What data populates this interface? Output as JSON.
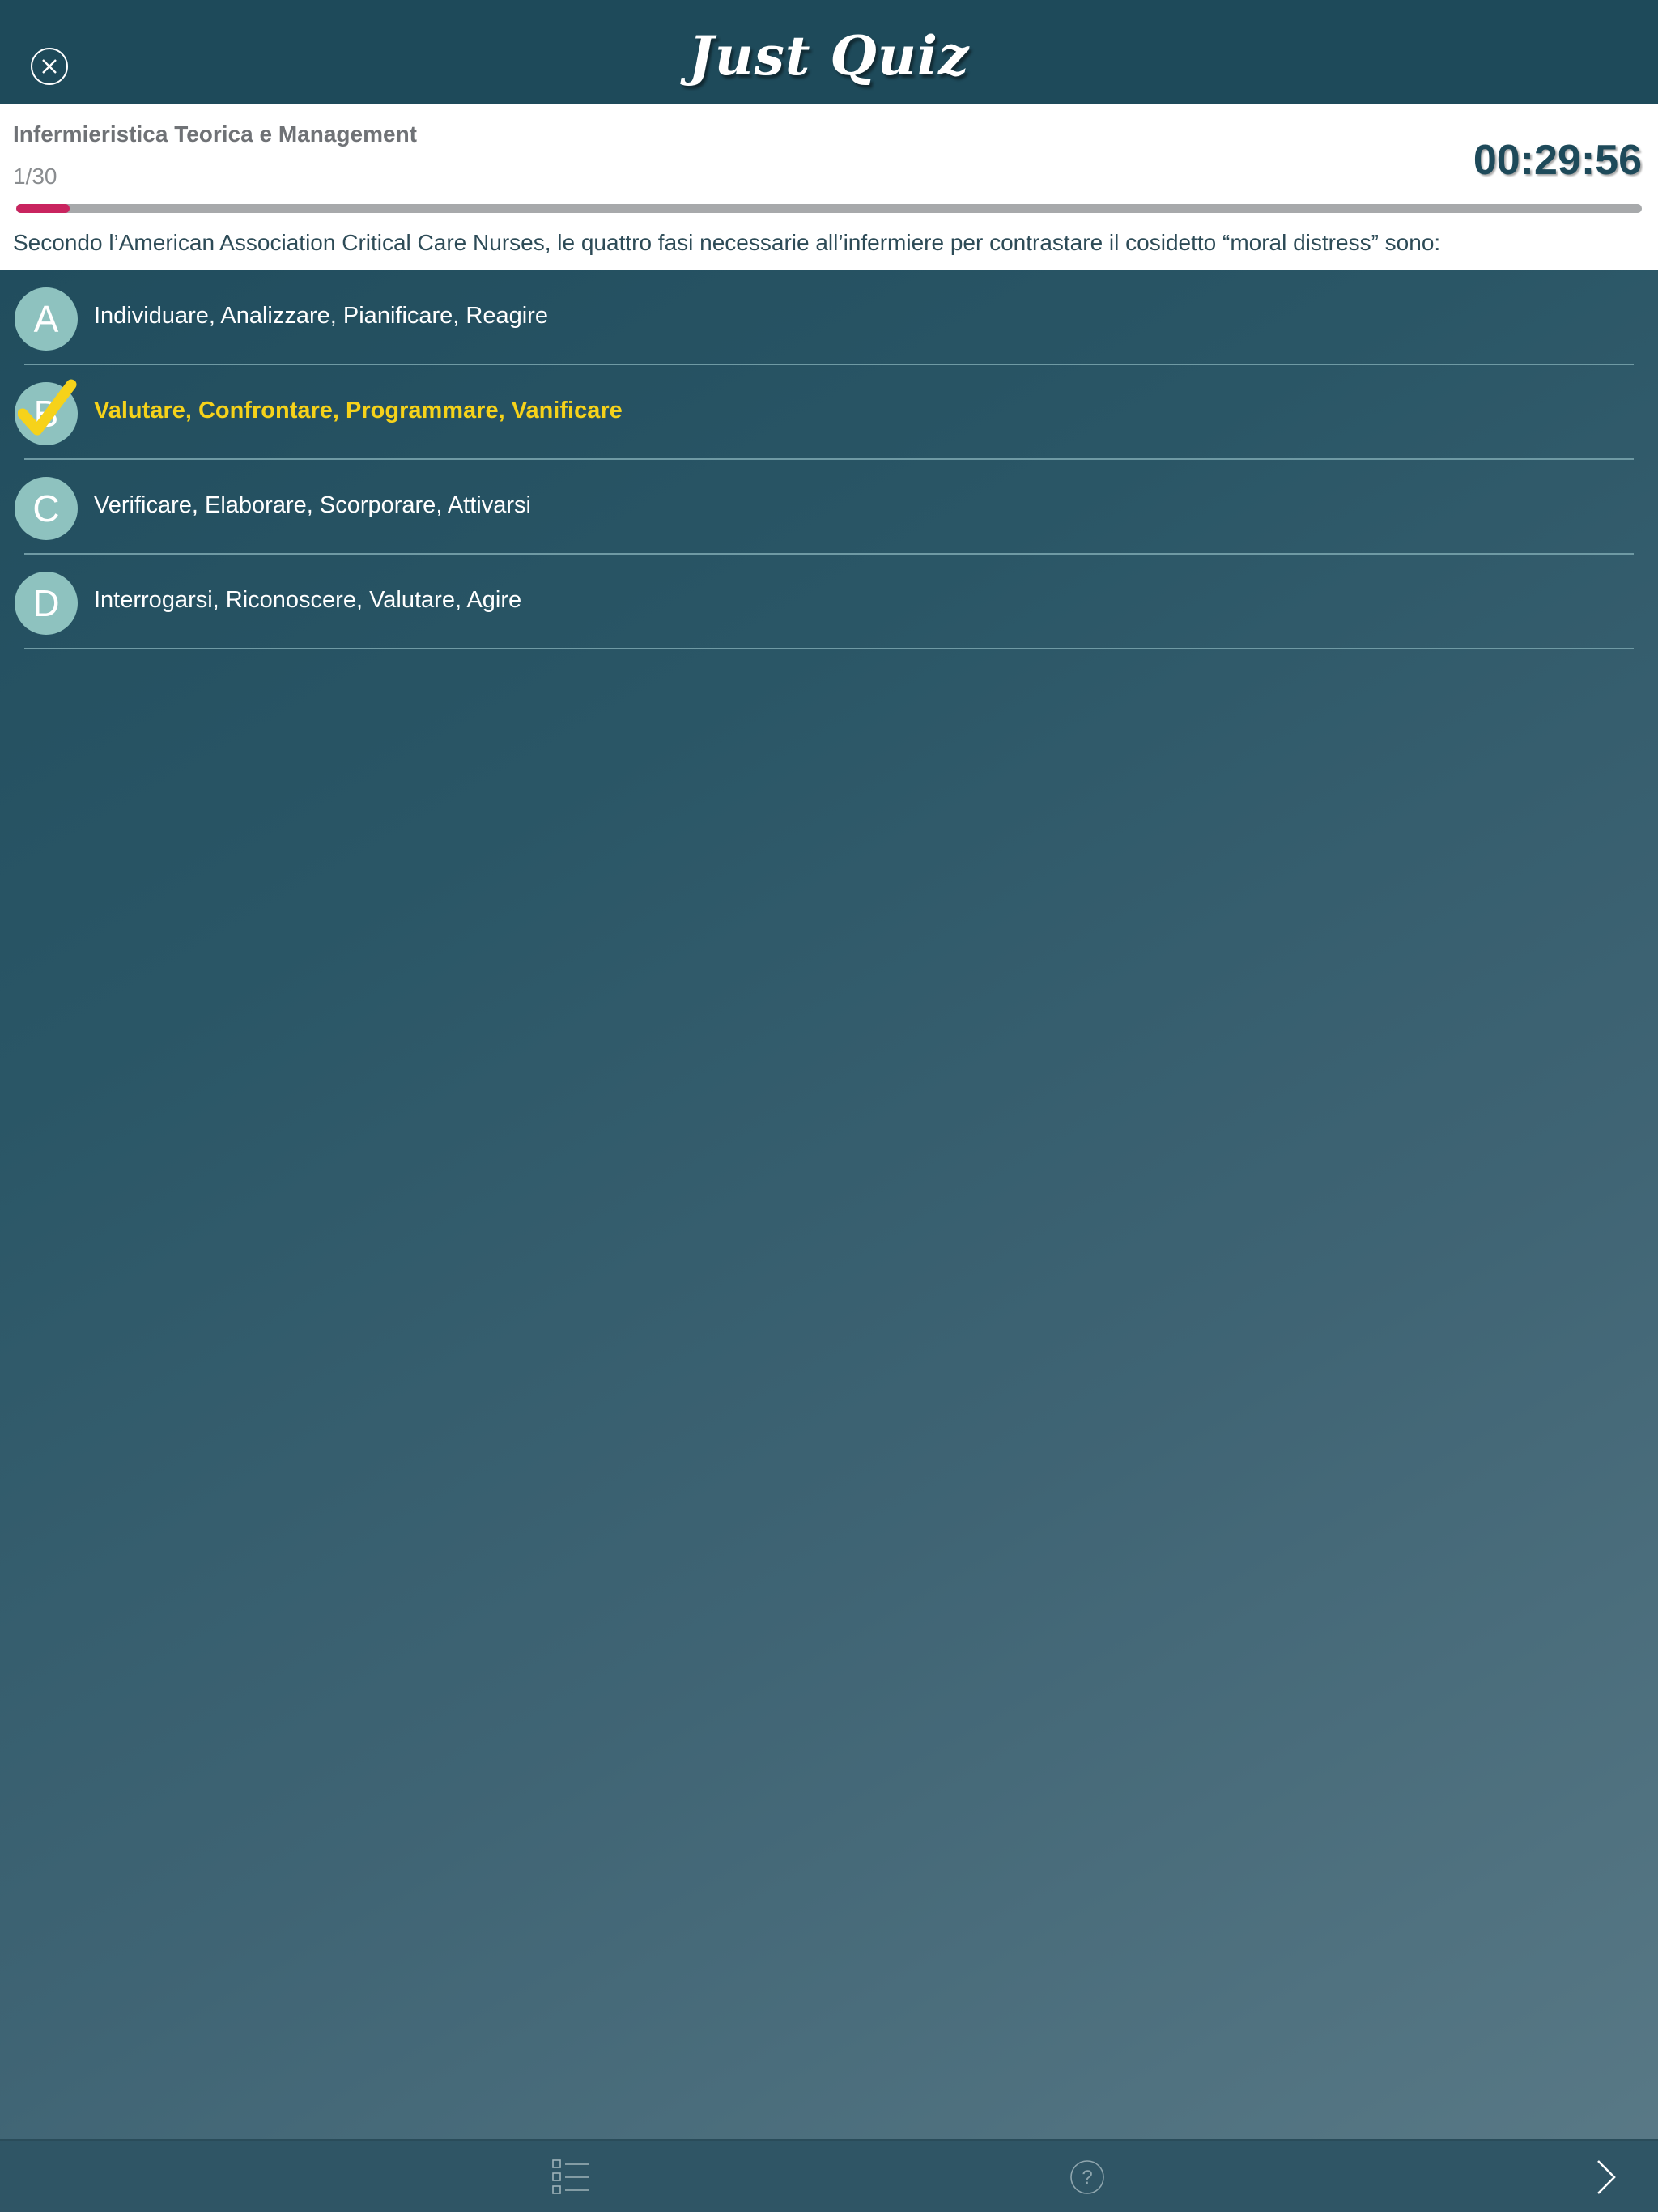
{
  "header": {
    "title": "Just Quiz",
    "close_icon": "close-circle-icon"
  },
  "quiz": {
    "subject": "Infermieristica Teorica e Management",
    "counter": "1/30",
    "timer": "00:29:56",
    "progress_fraction": 0.033,
    "question": "Secondo l’American Association Critical Care Nurses, le quattro fasi necessarie all’infermiere per contrastare il cosidetto “moral distress” sono:"
  },
  "answers": [
    {
      "letter": "A",
      "text": "Individuare, Analizzare, Pianificare, Reagire",
      "selected": false
    },
    {
      "letter": "B",
      "text": "Valutare, Confrontare, Programmare, Vanificare",
      "selected": true
    },
    {
      "letter": "C",
      "text": "Verificare, Elaborare, Scorporare, Attivarsi",
      "selected": false
    },
    {
      "letter": "D",
      "text": "Interrogarsi, Riconoscere, Valutare, Agire",
      "selected": false
    }
  ],
  "colors": {
    "accent": "#c9245f",
    "selected_text": "#f6d21a",
    "header_bg": "#1e4a5a",
    "answer_circle": "#8ec2bf"
  },
  "toolbar": {
    "list_icon": "question-list-icon",
    "help_icon": "help-icon",
    "next_icon": "chevron-right-icon"
  }
}
